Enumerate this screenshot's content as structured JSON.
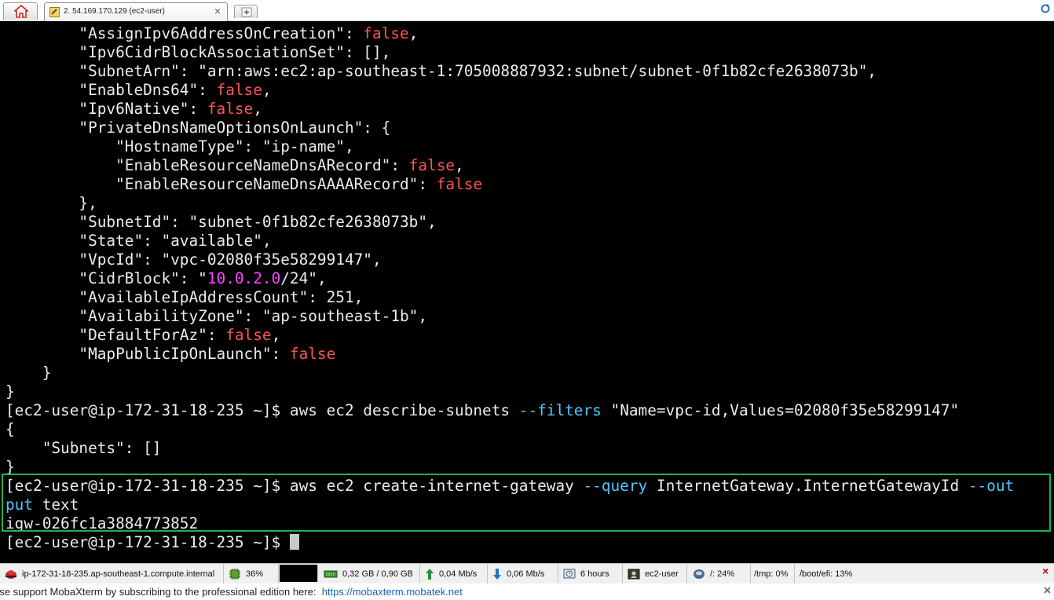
{
  "tabs": [
    {
      "label": "2. 54.169.170.129 (ec2-user)",
      "close": "×"
    }
  ],
  "terminal": {
    "lines": [
      [
        [
          "        \"AssignIpv6AddressOnCreation\": ",
          "txt"
        ],
        [
          "false",
          "false"
        ],
        [
          ",",
          "txt"
        ]
      ],
      [
        [
          "        \"Ipv6CidrBlockAssociationSet\": [],",
          "txt"
        ]
      ],
      [
        [
          "        \"SubnetArn\": \"arn:aws:ec2:ap-southeast-1:705008887932:subnet/subnet-0f1b82cfe2638073b\",",
          "txt"
        ]
      ],
      [
        [
          "        \"EnableDns64\": ",
          "txt"
        ],
        [
          "false",
          "false"
        ],
        [
          ",",
          "txt"
        ]
      ],
      [
        [
          "        \"Ipv6Native\": ",
          "txt"
        ],
        [
          "false",
          "false"
        ],
        [
          ",",
          "txt"
        ]
      ],
      [
        [
          "        \"PrivateDnsNameOptionsOnLaunch\": {",
          "txt"
        ]
      ],
      [
        [
          "            \"HostnameType\": \"ip-name\",",
          "txt"
        ]
      ],
      [
        [
          "            \"EnableResourceNameDnsARecord\": ",
          "txt"
        ],
        [
          "false",
          "false"
        ],
        [
          ",",
          "txt"
        ]
      ],
      [
        [
          "            \"EnableResourceNameDnsAAAARecord\": ",
          "txt"
        ],
        [
          "false",
          "false"
        ]
      ],
      [
        [
          "        },",
          "txt"
        ]
      ],
      [
        [
          "        \"SubnetId\": \"subnet-0f1b82cfe2638073b\",",
          "txt"
        ]
      ],
      [
        [
          "        \"State\": \"available\",",
          "txt"
        ]
      ],
      [
        [
          "        \"VpcId\": \"vpc-02080f35e58299147\",",
          "txt"
        ]
      ],
      [
        [
          "        \"CidrBlock\": \"",
          "txt"
        ],
        [
          "10.0.2.0",
          "ip"
        ],
        [
          "/24\",",
          "txt"
        ]
      ],
      [
        [
          "        \"AvailableIpAddressCount\": 251,",
          "txt"
        ]
      ],
      [
        [
          "        \"AvailabilityZone\": \"ap-southeast-1b\",",
          "txt"
        ]
      ],
      [
        [
          "        \"DefaultForAz\": ",
          "txt"
        ],
        [
          "false",
          "false"
        ],
        [
          ",",
          "txt"
        ]
      ],
      [
        [
          "        \"MapPublicIpOnLaunch\": ",
          "txt"
        ],
        [
          "false",
          "false"
        ]
      ],
      [
        [
          "    }",
          "txt"
        ]
      ],
      [
        [
          "}",
          "txt"
        ]
      ],
      [
        [
          "[ec2-user@ip-172-31-18-235 ~]$ aws ec2 describe-subnets ",
          "txt"
        ],
        [
          "--filters",
          "flag"
        ],
        [
          " \"Name=vpc-id,Values=02080f35e58299147\"",
          "txt"
        ]
      ],
      [
        [
          "{",
          "txt"
        ]
      ],
      [
        [
          "    \"Subnets\": []",
          "txt"
        ]
      ],
      [
        [
          "}",
          "txt"
        ]
      ],
      [
        [
          "[ec2-user@ip-172-31-18-235 ~]$ aws ec2 create-internet-gateway ",
          "txt"
        ],
        [
          "--query",
          "flag"
        ],
        [
          " InternetGateway.InternetGatewayId ",
          "txt"
        ],
        [
          "--out",
          "flag"
        ]
      ],
      [
        [
          "put",
          "flag"
        ],
        [
          " text",
          "txt"
        ]
      ],
      [
        [
          "igw-026fc1a3884773852",
          "txt"
        ]
      ],
      [
        [
          "[ec2-user@ip-172-31-18-235 ~]$ ",
          "txt"
        ]
      ]
    ]
  },
  "statusbar": {
    "host": "ip-172-31-18-235.ap-southeast-1.compute.internal",
    "cpu": "36%",
    "memory": "0,32 GB / 0,90 GB",
    "upload": "0,04 Mb/s",
    "download": "0,06 Mb/s",
    "uptime": "6 hours",
    "user": "ec2-user",
    "disk_root": "/: 24%",
    "disk_tmp": "/tmp: 0%",
    "disk_boot": "/boot/efi: 13%"
  },
  "message": {
    "text": "ase support MobaXterm by subscribing to the professional edition here:",
    "link": "https://mobaxterm.mobatek.net"
  },
  "colors": {
    "terminal_bg": "#000000",
    "terminal_fg": "#ececec",
    "false_literal": "#ff5555",
    "ip_literal": "#ff44ff",
    "cli_flag": "#4fc6ff",
    "highlight_box": "#21b44a"
  },
  "icons": [
    "home-icon",
    "terminal-tab-icon",
    "new-tab-icon",
    "refresh-icon",
    "linux-icon",
    "cpu-icon",
    "memory-icon",
    "upload-icon",
    "download-icon",
    "clock-icon",
    "user-icon",
    "disk-icon",
    "close-icon"
  ]
}
